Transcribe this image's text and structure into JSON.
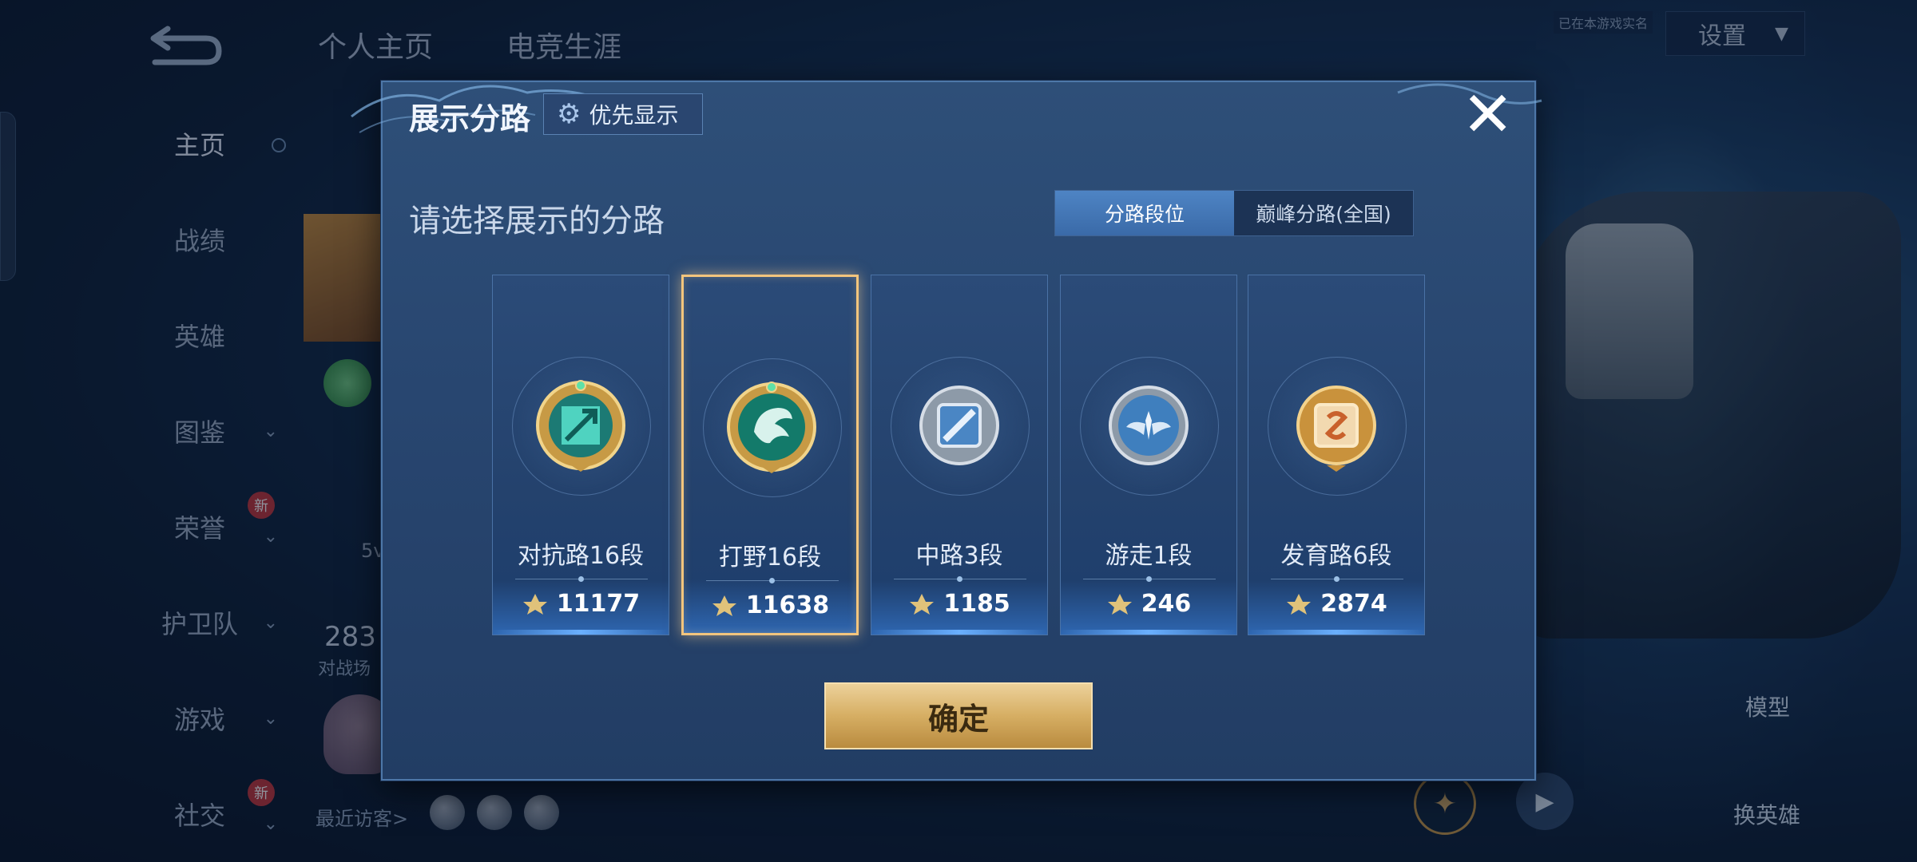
{
  "nav": {
    "back_icon": "back-arrow-icon",
    "menu": [
      {
        "label": "主页",
        "active": true,
        "has_chevron": false,
        "new": false
      },
      {
        "label": "战绩",
        "active": false,
        "has_chevron": false,
        "new": false
      },
      {
        "label": "英雄",
        "active": false,
        "has_chevron": false,
        "new": false
      },
      {
        "label": "图鉴",
        "active": false,
        "has_chevron": true,
        "new": false
      },
      {
        "label": "荣誉",
        "active": false,
        "has_chevron": true,
        "new": true
      },
      {
        "label": "护卫队",
        "active": false,
        "has_chevron": true,
        "new": false
      },
      {
        "label": "游戏",
        "active": false,
        "has_chevron": true,
        "new": false
      },
      {
        "label": "社交",
        "active": false,
        "has_chevron": true,
        "new": true
      }
    ],
    "new_badge": "新"
  },
  "top_tabs": [
    "个人主页",
    "电竞生涯"
  ],
  "settings": {
    "label": "设置",
    "game_note": "已在本游戏实名"
  },
  "background": {
    "partial_5v": "5v",
    "partial_num": "283",
    "partial_sub": "对战场",
    "recent_visitors": "最近访客>",
    "model_label": "模型",
    "swap_hero_label": "换英雄"
  },
  "modal": {
    "title": "展示分路",
    "priority_button": "优先显示",
    "subtitle": "请选择展示的分路",
    "tabs": [
      {
        "label": "分路段位",
        "active": true
      },
      {
        "label": "巅峰分路(全国)",
        "active": false
      }
    ],
    "lanes": [
      {
        "name": "对抗路16段",
        "score": "11177",
        "selected": false,
        "icon": "clash-lane-emblem-icon"
      },
      {
        "name": "打野16段",
        "score": "11638",
        "selected": true,
        "icon": "jungle-dragon-emblem-icon"
      },
      {
        "name": "中路3段",
        "score": "1185",
        "selected": false,
        "icon": "mid-lane-emblem-icon"
      },
      {
        "name": "游走1段",
        "score": "246",
        "selected": false,
        "icon": "roam-wings-emblem-icon"
      },
      {
        "name": "发育路6段",
        "score": "2874",
        "selected": false,
        "icon": "farm-lane-emblem-icon"
      }
    ],
    "confirm": "确定"
  },
  "colors": {
    "modal_bg": "#284670",
    "accent_gold": "#d6ae63",
    "selected_border": "#f3c57d",
    "tab_active": "#4378b8"
  }
}
